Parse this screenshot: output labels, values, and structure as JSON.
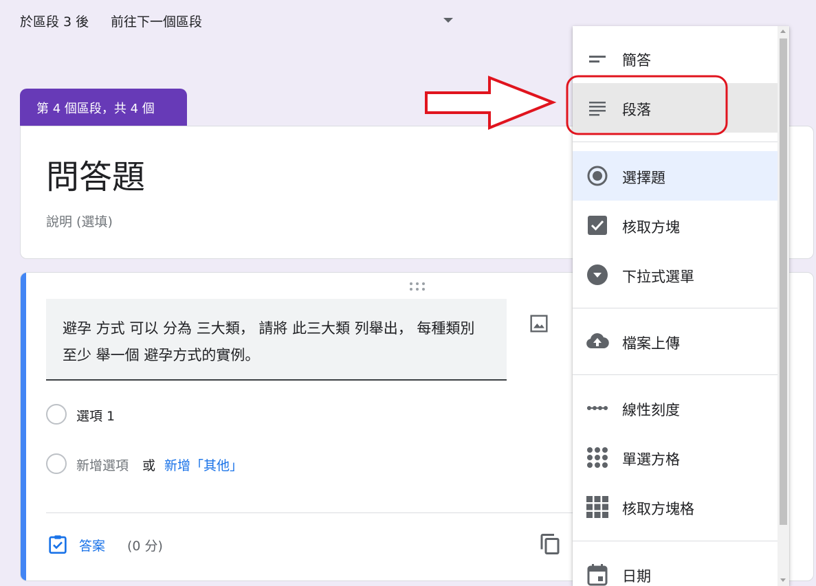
{
  "topbar": {
    "after_section": "於區段 3 後",
    "goto": "前往下一個區段"
  },
  "section": {
    "tab": "第 4 個區段，共 4 個",
    "title": "問答題",
    "description_placeholder": "說明 (選填)"
  },
  "question": {
    "text": "避孕 方式 可以 分為 三大類， 請將 此三大類 列舉出， 每種類別 至少 舉一個 避孕方式的實例。",
    "option1": "選項 1",
    "add_option": "新增選項",
    "or": "或",
    "add_other": "新增「其他」",
    "answer_key": "答案",
    "points": "(0 分)"
  },
  "menu": {
    "items": [
      {
        "label": "簡答",
        "icon": "short-text-icon"
      },
      {
        "label": "段落",
        "icon": "paragraph-icon"
      },
      {
        "label": "選擇題",
        "icon": "radio-button-icon"
      },
      {
        "label": "核取方塊",
        "icon": "checkbox-icon"
      },
      {
        "label": "下拉式選單",
        "icon": "dropdown-icon"
      },
      {
        "label": "檔案上傳",
        "icon": "cloud-upload-icon"
      },
      {
        "label": "線性刻度",
        "icon": "linear-scale-icon"
      },
      {
        "label": "單選方格",
        "icon": "multiple-choice-grid-icon"
      },
      {
        "label": "核取方塊格",
        "icon": "checkbox-grid-icon"
      },
      {
        "label": "日期",
        "icon": "calendar-icon"
      }
    ],
    "hovered": "段落",
    "selected": "選擇題"
  },
  "colors": {
    "accent_purple": "#673ab7",
    "accent_blue": "#4285f4",
    "link_blue": "#1a73e8",
    "annotation_red": "#e0141e"
  }
}
